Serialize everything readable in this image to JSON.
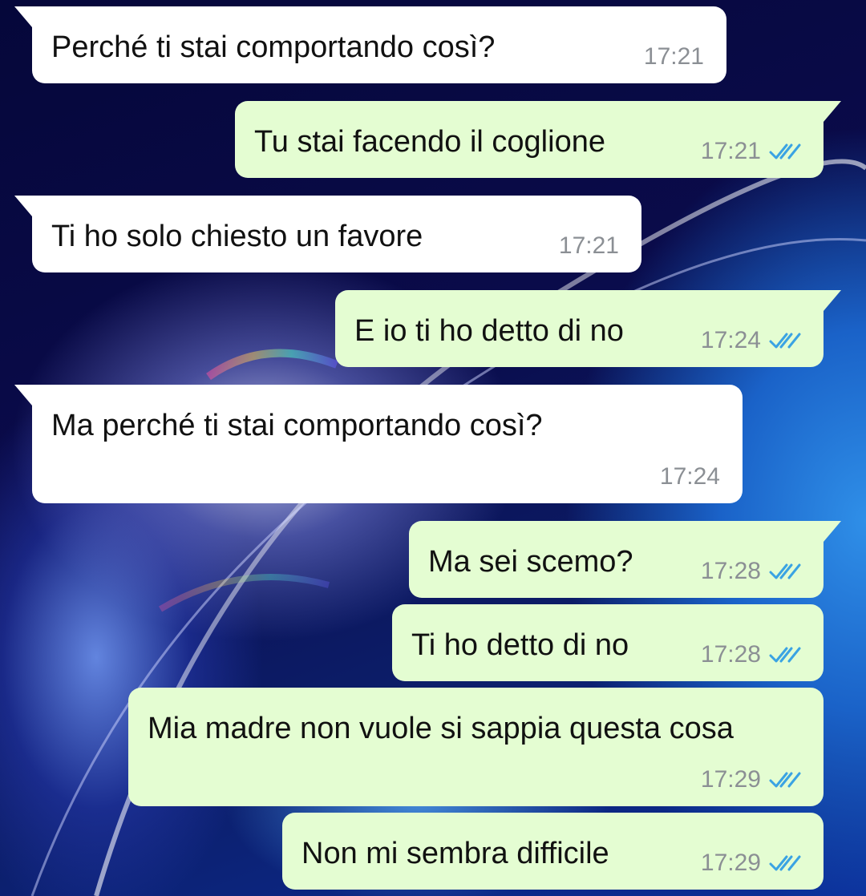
{
  "messages": [
    {
      "text": "Perché ti stai comportando così?",
      "time": "17:21",
      "direction": "in",
      "ticks": ""
    },
    {
      "text": "Tu stai facendo il coglione",
      "time": "17:21",
      "direction": "out",
      "ticks": "read-double-check-icon"
    },
    {
      "text": "Ti ho solo chiesto un favore",
      "time": "17:21",
      "direction": "in",
      "ticks": ""
    },
    {
      "text": "E io ti ho detto di no",
      "time": "17:24",
      "direction": "out",
      "ticks": "read-double-check-icon"
    },
    {
      "text": "Ma perché ti stai comportando così?",
      "time": "17:24",
      "direction": "in",
      "ticks": ""
    },
    {
      "text": "Ma sei scemo?",
      "time": "17:28",
      "direction": "out",
      "ticks": "read-double-check-icon"
    },
    {
      "text": "Ti ho detto di no",
      "time": "17:28",
      "direction": "out",
      "ticks": "read-double-check-icon"
    },
    {
      "text": "Mia madre non vuole si sappia questa cosa",
      "time": "17:29",
      "direction": "out",
      "ticks": "read-double-check-icon"
    },
    {
      "text": "Non mi sembra difficile",
      "time": "17:29",
      "direction": "out",
      "ticks": "read-double-check-icon"
    }
  ],
  "colors": {
    "incoming_bubble": "#ffffff",
    "outgoing_bubble": "#e4fdd2",
    "timestamp": "#8b8f94",
    "read_ticks": "#3aa3e3"
  }
}
